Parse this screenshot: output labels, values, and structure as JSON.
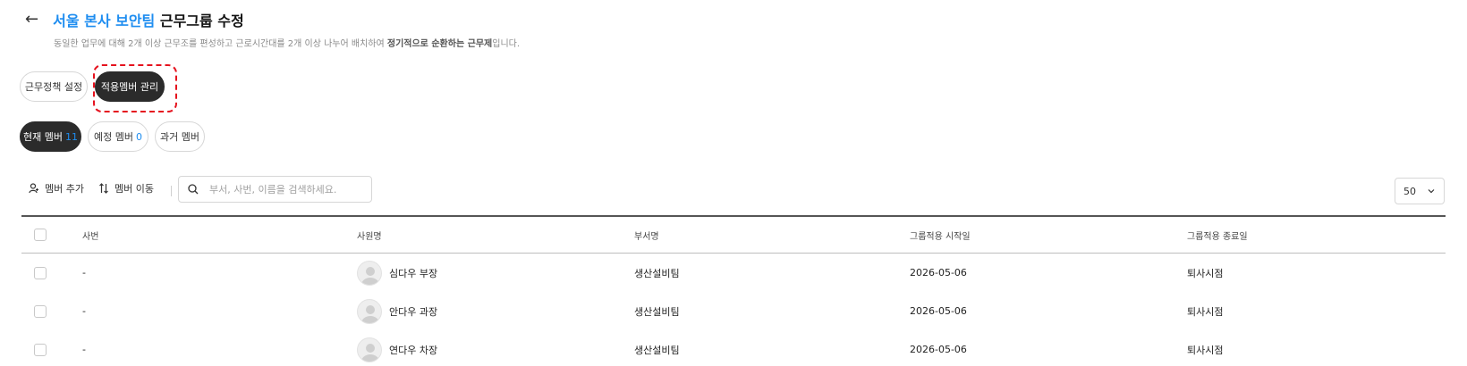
{
  "header": {
    "back_icon": "←",
    "title_accent": "서울 본사 보안팀",
    "title_rest": " 근무그룹 수정",
    "subtitle_pre": "동일한 업무에 대해 2개 이상 근무조를 편성하고 근로시간대를 2개 이상 나누어 배치하여 ",
    "subtitle_bold": "정기적으로 순환하는 근무제",
    "subtitle_post": "입니다."
  },
  "tabs": [
    {
      "label": "근무정책 설정",
      "active": false
    },
    {
      "label": "적용멤버 관리",
      "active": true
    }
  ],
  "member_tabs": [
    {
      "label": "현재 멤버",
      "count": "11",
      "active": true
    },
    {
      "label": "예정 멤버",
      "count": "0",
      "active": false
    },
    {
      "label": "과거 멤버",
      "count": "",
      "active": false
    }
  ],
  "toolbar": {
    "add_icon": "person-add-icon",
    "add_label": "멤버 추가",
    "move_icon": "sort-arrows-icon",
    "move_label": "멤버 이동",
    "search_icon": "search-icon",
    "search_placeholder": "부서, 사번, 이름을 검색하세요.",
    "page_size": "50",
    "page_size_icon": "chevron-down-icon"
  },
  "table": {
    "columns": [
      "사번",
      "사원명",
      "부서명",
      "그룹적용 시작일",
      "그룹적용 종료일"
    ],
    "rows": [
      {
        "id": "-",
        "name": "심다우 부장",
        "dept": "생산설비팀",
        "start": "2026-05-06",
        "end": "퇴사시점"
      },
      {
        "id": "-",
        "name": "안다우 과장",
        "dept": "생산설비팀",
        "start": "2026-05-06",
        "end": "퇴사시점"
      },
      {
        "id": "-",
        "name": "연다우 차장",
        "dept": "생산설비팀",
        "start": "2026-05-06",
        "end": "퇴사시점"
      }
    ]
  },
  "colors": {
    "accent": "#1e8df0",
    "dark_pill": "#2b2b2b",
    "highlight": "#e5121e"
  }
}
